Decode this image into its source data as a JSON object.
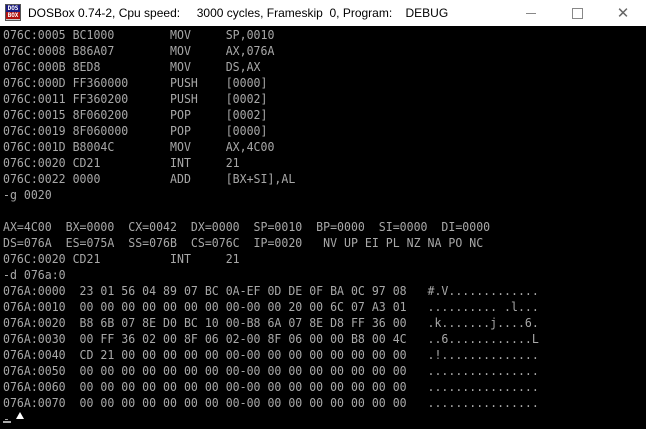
{
  "window": {
    "title": "DOSBox 0.74-2, Cpu speed:     3000 cycles, Frameskip  0, Program:    DEBUG",
    "icon_text_top": "DOS",
    "icon_text_bottom": "BOX",
    "controls": [
      "minimize-icon",
      "maximize-icon",
      "close-icon"
    ],
    "close_glyph": "✕"
  },
  "terminal": {
    "lines": [
      "076C:0005 BC1000        MOV     SP,0010",
      "076C:0008 B86A07        MOV     AX,076A",
      "076C:000B 8ED8          MOV     DS,AX",
      "076C:000D FF360000      PUSH    [0000]",
      "076C:0011 FF360200      PUSH    [0002]",
      "076C:0015 8F060200      POP     [0002]",
      "076C:0019 8F060000      POP     [0000]",
      "076C:001D B8004C        MOV     AX,4C00",
      "076C:0020 CD21          INT     21",
      "076C:0022 0000          ADD     [BX+SI],AL",
      "-g 0020",
      "",
      "AX=4C00  BX=0000  CX=0042  DX=0000  SP=0010  BP=0000  SI=0000  DI=0000",
      "DS=076A  ES=075A  SS=076B  CS=076C  IP=0020   NV UP EI PL NZ NA PO NC",
      "076C:0020 CD21          INT     21",
      "-d 076a:0",
      "076A:0000  23 01 56 04 89 07 BC 0A-EF 0D DE 0F BA 0C 97 08   #.V.............",
      "076A:0010  00 00 00 00 00 00 00 00-00 00 20 00 6C 07 A3 01   .......... .l...",
      "076A:0020  B8 6B 07 8E D0 BC 10 00-B8 6A 07 8E D8 FF 36 00   .k.......j....6.",
      "076A:0030  00 FF 36 02 00 8F 06 02-00 8F 06 00 00 B8 00 4C   ..6............L",
      "076A:0040  CD 21 00 00 00 00 00 00-00 00 00 00 00 00 00 00   .!..............",
      "076A:0050  00 00 00 00 00 00 00 00-00 00 00 00 00 00 00 00   ................",
      "076A:0060  00 00 00 00 00 00 00 00-00 00 00 00 00 00 00 00   ................",
      "076A:0070  00 00 00 00 00 00 00 00-00 00 00 00 00 00 00 00   ................",
      "-"
    ]
  },
  "colors": {
    "terminal_bg": "#000000",
    "terminal_fg": "#a8a8a8",
    "titlebar_bg": "#ffffff"
  }
}
